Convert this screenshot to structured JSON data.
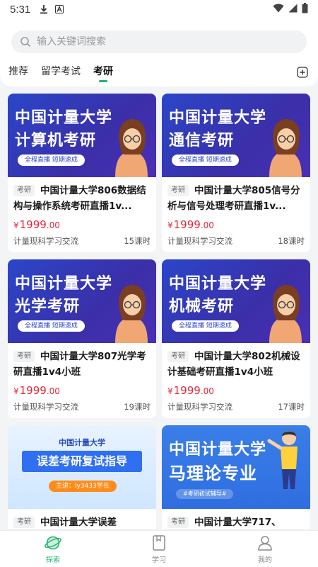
{
  "status_bar": {
    "time": "5:31"
  },
  "search": {
    "placeholder": "输入关键词搜索"
  },
  "tabs": [
    {
      "label": "推荐",
      "active": false
    },
    {
      "label": "留学考试",
      "active": false
    },
    {
      "label": "考研",
      "active": true
    }
  ],
  "courses": [
    {
      "banner_line1": "中国计量大学",
      "banner_line2": "计算机考研",
      "banner_tag": "全程直播   短期速成",
      "category": "考研",
      "title": "中国计量大学806数据结构与操作系统考研直播1v...",
      "price_symbol": "¥",
      "price_int": "1999",
      "price_dec": ".00",
      "provider": "计量现科学习交流",
      "lessons": "15课时"
    },
    {
      "banner_line1": "中国计量大学",
      "banner_line2": "通信考研",
      "banner_tag": "全程直播   短期速成",
      "category": "考研",
      "title": "中国计量大学805信号分析与信号处理考研直播1v...",
      "price_symbol": "¥",
      "price_int": "1999",
      "price_dec": ".00",
      "provider": "计量现科学习交流",
      "lessons": "18课时"
    },
    {
      "banner_line1": "中国计量大学",
      "banner_line2": "光学考研",
      "banner_tag": "全程直播   短期速成",
      "category": "考研",
      "title": "中国计量大学807光学考研直播1v4小班",
      "price_symbol": "¥",
      "price_int": "1999",
      "price_dec": ".00",
      "provider": "计量现科学习交流",
      "lessons": "19课时"
    },
    {
      "banner_line1": "中国计量大学",
      "banner_line2": "机械考研",
      "banner_tag": "全程直播   短期速成",
      "category": "考研",
      "title": "中国计量大学802机械设计基础考研直播1v4小班",
      "price_symbol": "¥",
      "price_int": "1999",
      "price_dec": ".00",
      "provider": "计量现科学习交流",
      "lessons": "17课时"
    },
    {
      "banner_small": "中国计量大学",
      "banner_big": "误差考研复试指导",
      "banner_pill": "主讲：ly3433学长",
      "category": "考研",
      "title": "中国计量大学误差"
    },
    {
      "banner_line1": "中国计量大学",
      "banner_line2": "马理论专业",
      "banner_tag": "#考研初试辅导#",
      "category": "考研",
      "title": "中国计量大学717、"
    }
  ],
  "bottom_nav": [
    {
      "label": "探索",
      "icon": "planet-icon",
      "active": true
    },
    {
      "label": "学习",
      "icon": "book-icon",
      "active": false
    },
    {
      "label": "我的",
      "icon": "person-icon",
      "active": false
    }
  ],
  "colors": {
    "accent": "#21b573",
    "price": "#e5273a",
    "banner_blue": "#2a46c9"
  }
}
